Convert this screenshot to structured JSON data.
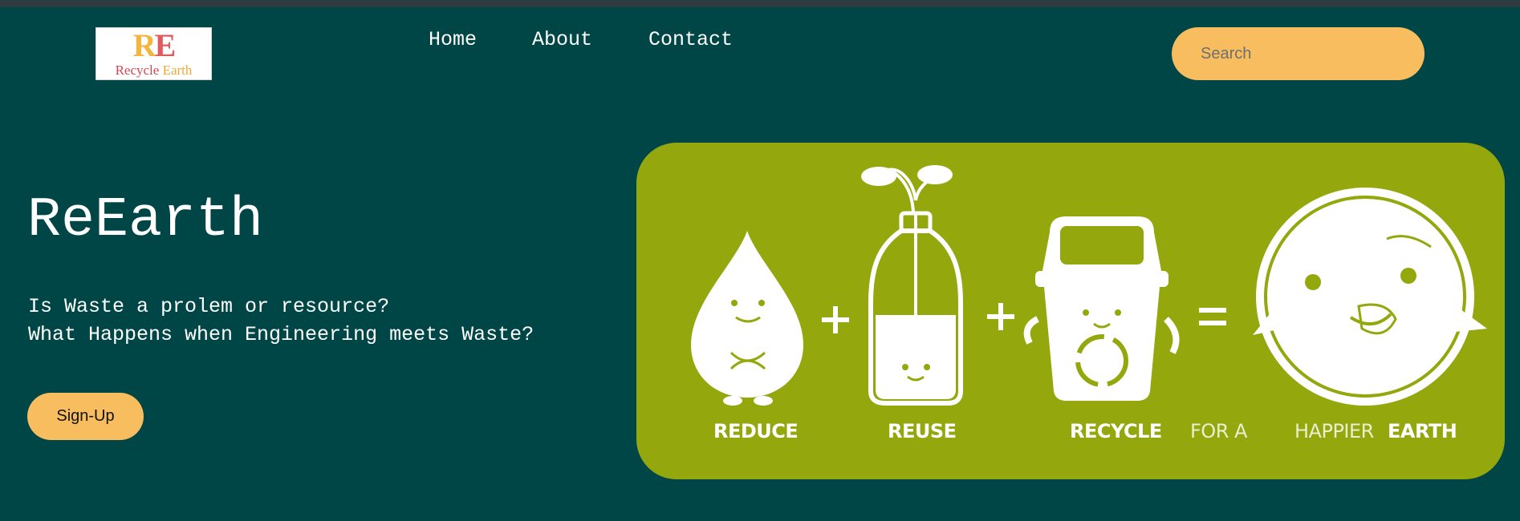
{
  "logo": {
    "mark_r": "R",
    "mark_e": "E",
    "word1": "Recycle",
    "word2": "Earth"
  },
  "nav": {
    "items": [
      {
        "label": "Home"
      },
      {
        "label": "About"
      },
      {
        "label": "Contact"
      }
    ]
  },
  "search": {
    "placeholder": "Search",
    "value": ""
  },
  "hero": {
    "title": "ReEarth",
    "subtitle_lines": [
      "Is Waste a prolem or resource?",
      "What Happens when Engineering meets Waste?"
    ],
    "signup_label": "Sign-Up"
  },
  "banner": {
    "labels": {
      "reduce": "REDUCE",
      "reuse": "REUSE",
      "recycle": "RECYCLE",
      "for_a": "FOR A",
      "happier": "HAPPIER",
      "earth": "EARTH"
    },
    "operators": {
      "plus": "+",
      "equals": "="
    }
  },
  "colors": {
    "background": "#004646",
    "accent": "#f8bd5f",
    "banner": "#94a70d",
    "text": "#ffffff"
  }
}
